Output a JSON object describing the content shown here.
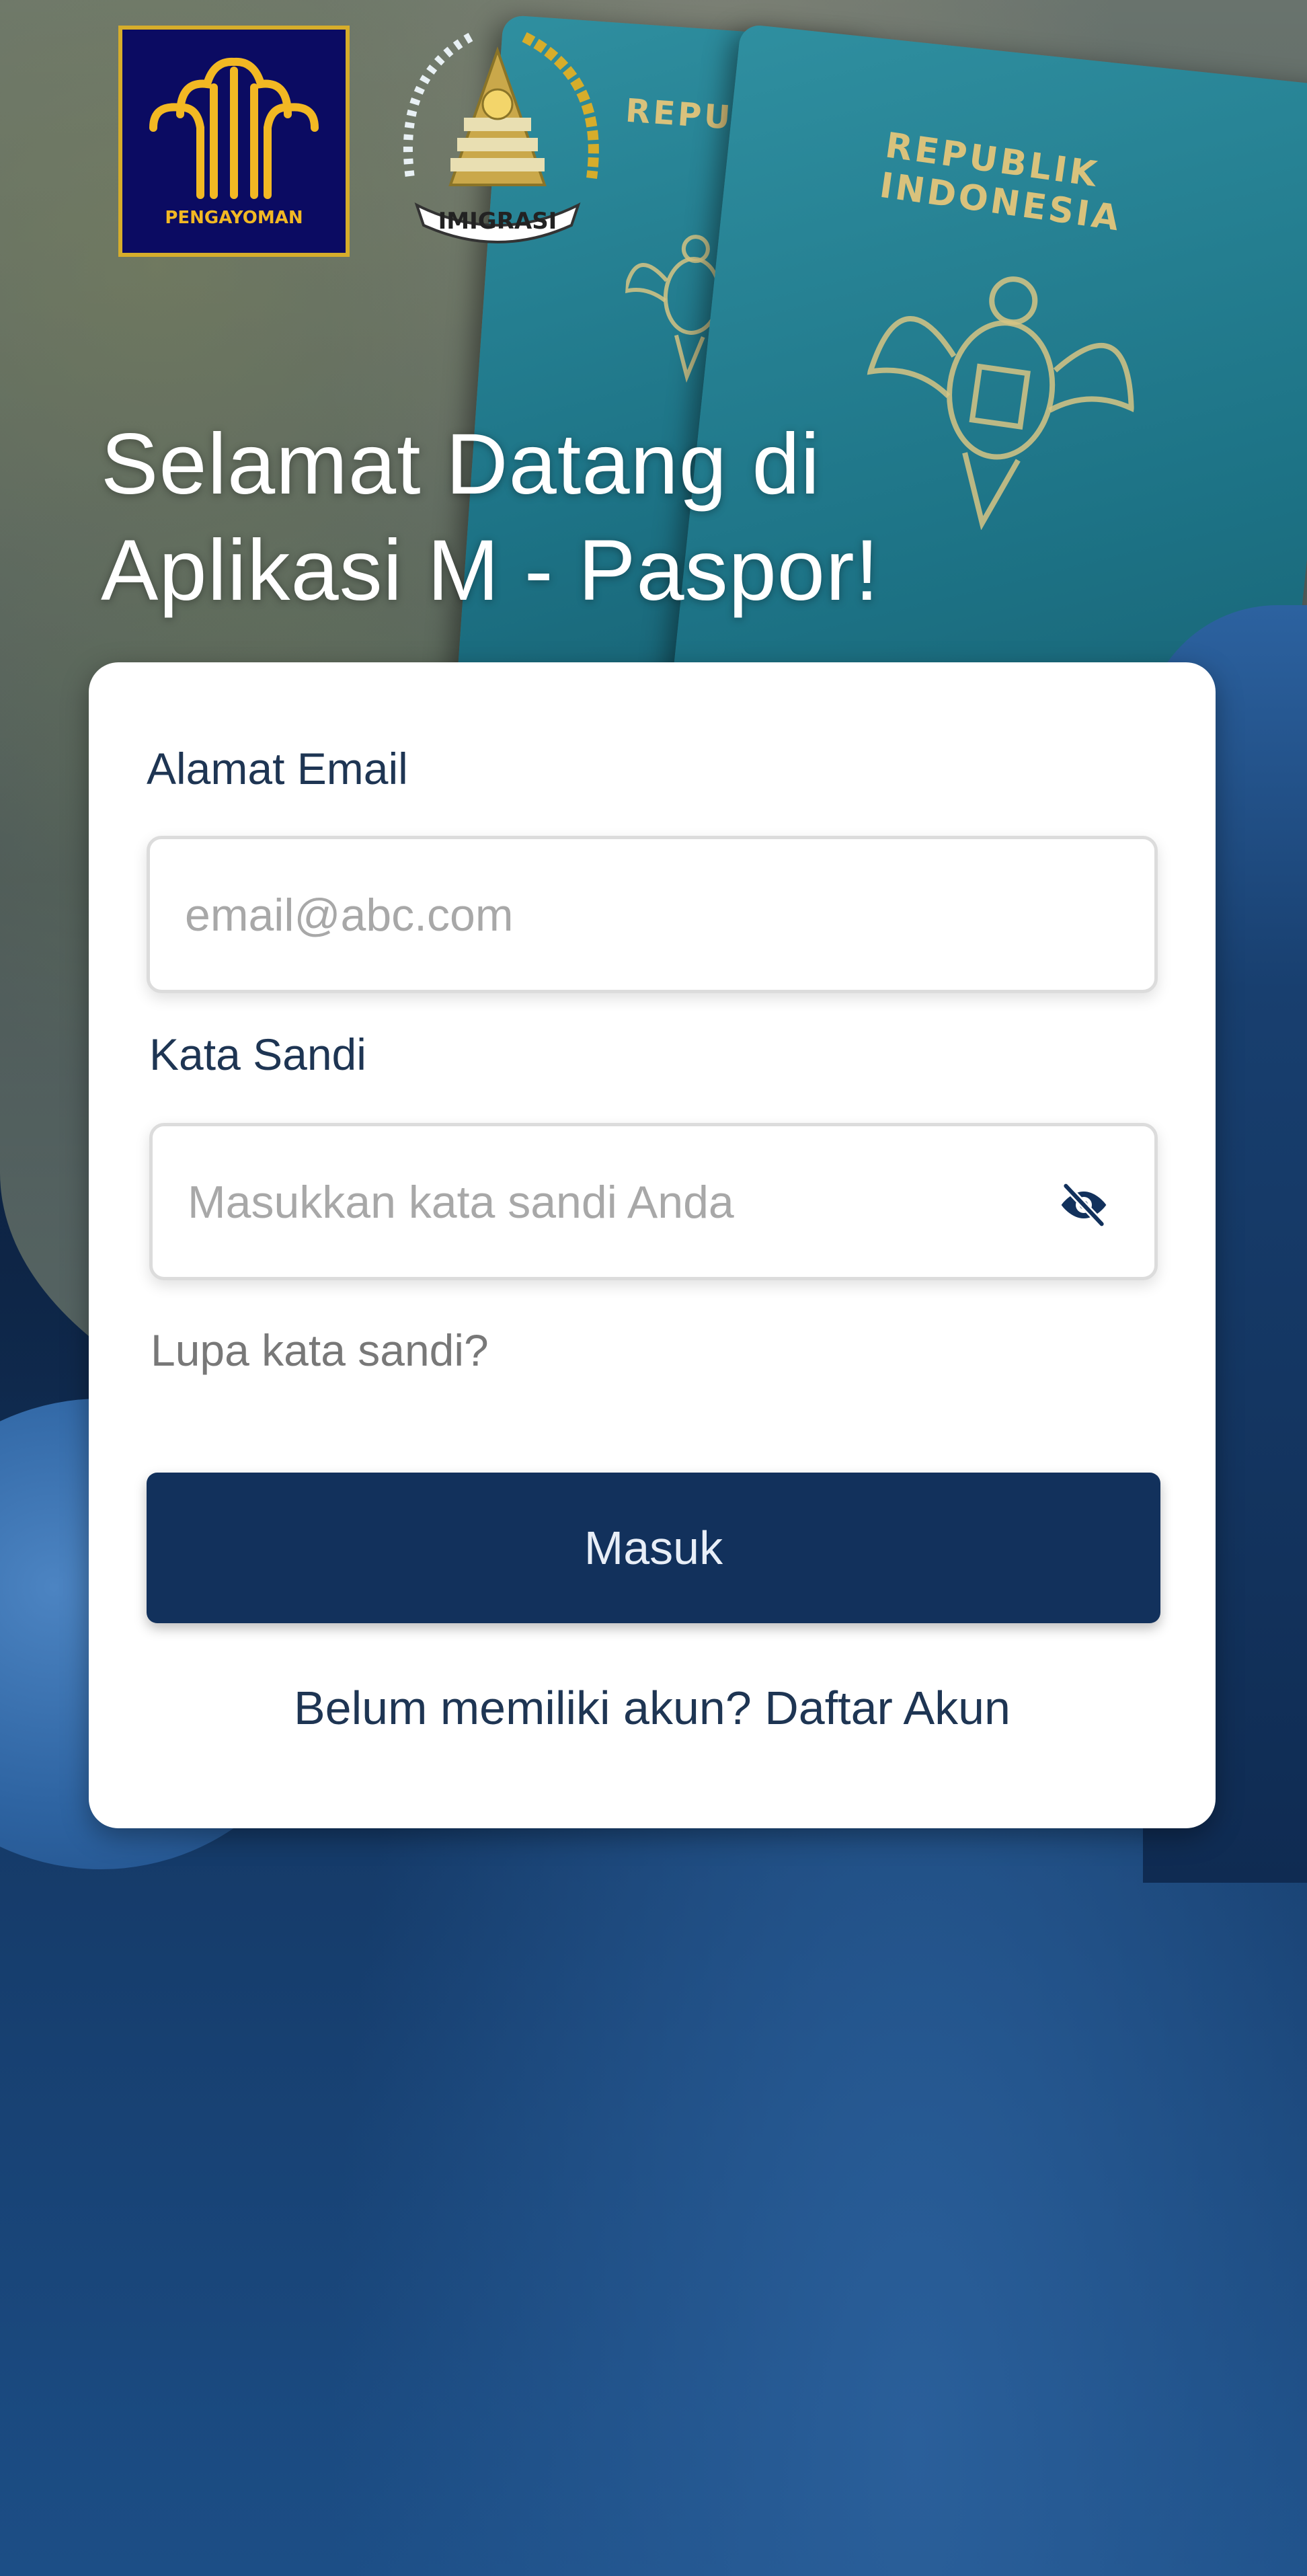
{
  "header": {
    "logo_left_text": "PENGAYOMAN",
    "logo_right_text": "IMIGRASI",
    "passport_text": "REPUBLIK INDONESIA",
    "passport_text_short": "REPUBLIK IN",
    "title_line1": "Selamat Datang di",
    "title_line2": "Aplikasi M - Paspor!"
  },
  "form": {
    "email_label": "Alamat Email",
    "email_placeholder": "email@abc.com",
    "email_value": "",
    "password_label": "Kata Sandi",
    "password_placeholder": "Masukkan kata sandi Anda",
    "password_value": "",
    "password_toggle_icon": "eye-off-icon",
    "forgot_password": "Lupa kata sandi?",
    "login_button": "Masuk",
    "register_prompt": "Belum memiliki akun?",
    "register_link": "Daftar Akun"
  },
  "colors": {
    "primary": "#12315c",
    "gold": "#d6ad2b",
    "logo_bg": "#0b0b62",
    "text_dark": "#1e3553",
    "placeholder": "#a8a8a8"
  }
}
